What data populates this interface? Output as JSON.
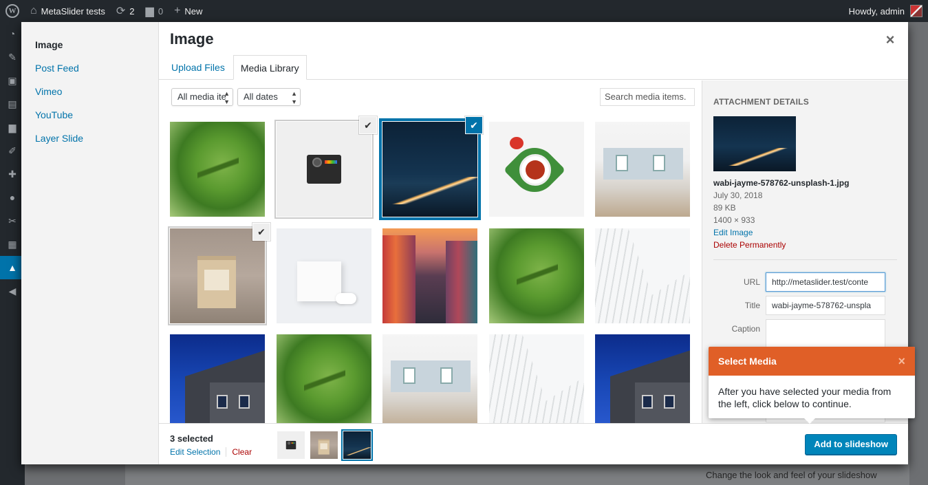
{
  "adminbar": {
    "site_name": "MetaSlider tests",
    "updates_count": "2",
    "comments_count": "0",
    "new_label": "New",
    "greeting": "Howdy, admin"
  },
  "background": {
    "hint_text": "Change the look and feel of your slideshow"
  },
  "modal": {
    "title": "Image",
    "close_icon": "×",
    "menu": [
      {
        "label": "Image"
      },
      {
        "label": "Post Feed"
      },
      {
        "label": "Vimeo"
      },
      {
        "label": "YouTube"
      },
      {
        "label": "Layer Slide"
      }
    ],
    "tabs": [
      {
        "label": "Upload Files"
      },
      {
        "label": "Media Library"
      }
    ],
    "filters": {
      "type_filter": "All media ite",
      "date_filter": "All dates",
      "search_placeholder": "Search media items."
    }
  },
  "attachment_details": {
    "heading": "ATTACHMENT DETAILS",
    "filename": "wabi-jayme-578762-unsplash-1.jpg",
    "date": "July 30, 2018",
    "filesize": "89 KB",
    "dimensions": "1400 × 933",
    "edit_link": "Edit Image",
    "delete_link": "Delete Permanently",
    "url_label": "URL",
    "url_value": "http://metaslider.test/conte",
    "title_label": "Title",
    "title_value": "wabi-jayme-578762-unspla",
    "caption_label": "Caption"
  },
  "bottombar": {
    "selected_count": "3 selected",
    "edit_selection": "Edit Selection",
    "clear": "Clear",
    "add_button": "Add to slideshow"
  },
  "tooltip": {
    "title": "Select Media",
    "close_icon": "×",
    "body": "After you have selected your media from the left, click below to continue."
  },
  "colors": {
    "accent": "#0073aa",
    "button": "#0085ba",
    "tooltip_header": "#e05f27",
    "danger": "#a00"
  }
}
